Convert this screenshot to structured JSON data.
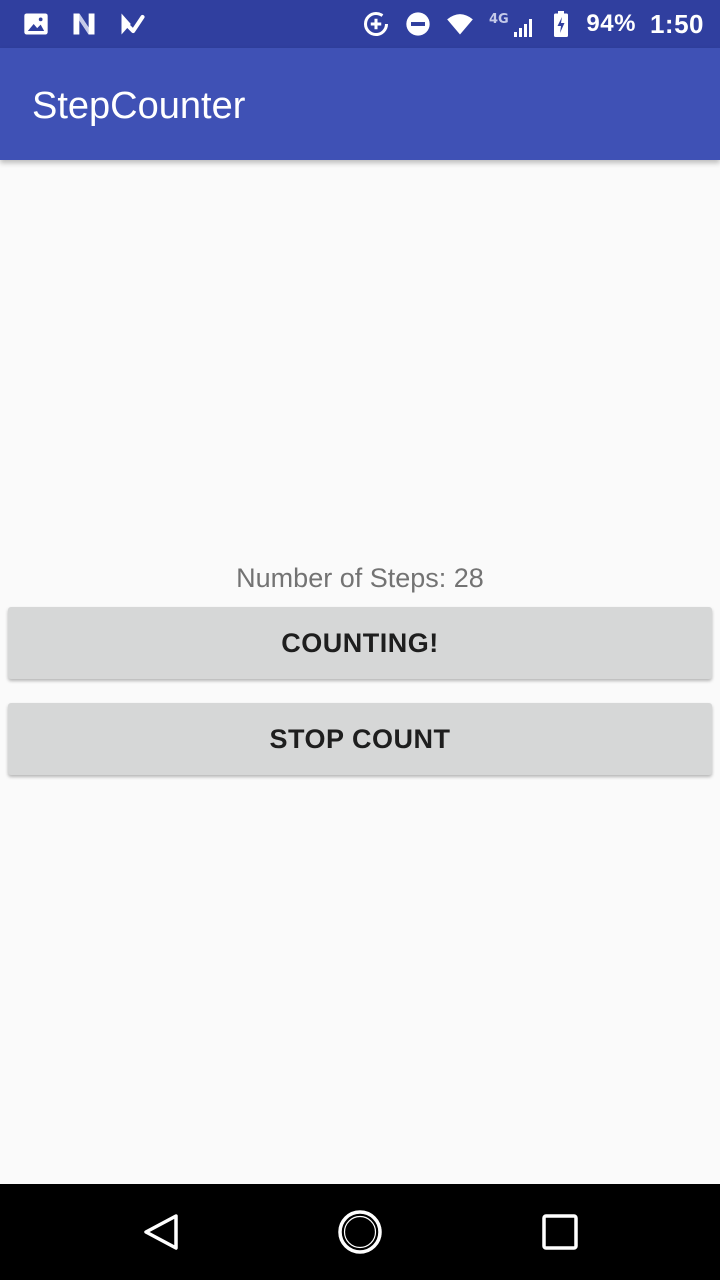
{
  "status_bar": {
    "left_icons": [
      "image-icon",
      "n-app-icon",
      "check-notification-icon"
    ],
    "right_icons": [
      "data-saver-icon",
      "do-not-disturb-icon",
      "wifi-icon",
      "4g-lte-signal-icon",
      "battery-charging-icon"
    ],
    "network_label": "4G",
    "battery_percent": "94%",
    "time": "1:50"
  },
  "app_bar": {
    "title": "StepCounter"
  },
  "main": {
    "steps_text": "Number of Steps: 28",
    "counting_button_label": "COUNTING!",
    "stop_button_label": "STOP COUNT"
  },
  "nav_bar": {
    "icons": [
      "back-icon",
      "home-icon",
      "recents-icon"
    ]
  },
  "colors": {
    "status_bar": "#303f9f",
    "app_bar": "#3f51b5",
    "background": "#fafafa",
    "button": "#d6d7d7",
    "steps_text": "#737373"
  }
}
